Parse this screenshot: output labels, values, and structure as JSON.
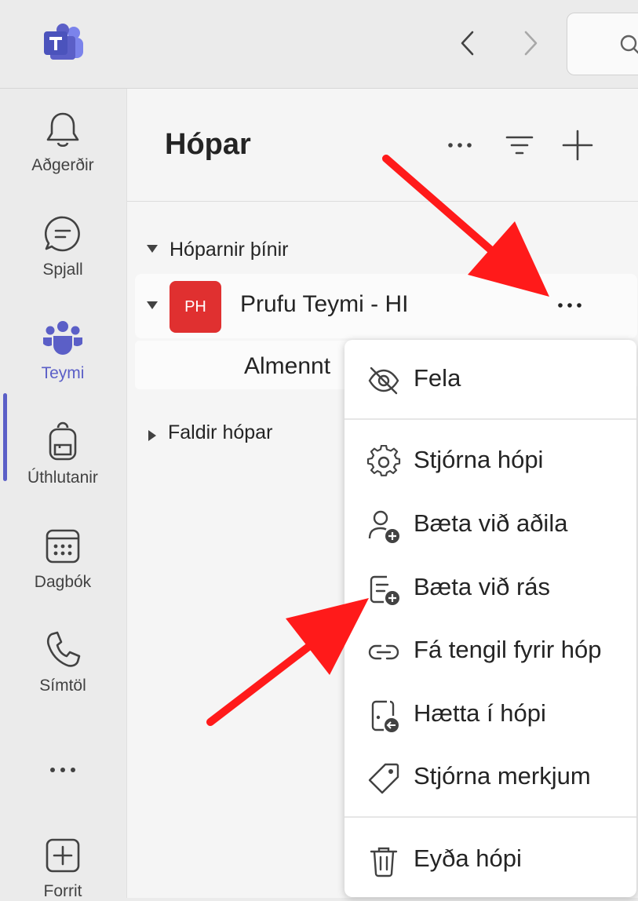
{
  "colors": {
    "accent": "#5b5fc7",
    "team_avatar": "#e03030",
    "annotation_arrow": "#ff0000"
  },
  "rail": {
    "items": [
      {
        "label": "Aðgerðir",
        "icon": "bell-icon"
      },
      {
        "label": "Spjall",
        "icon": "chat-icon"
      },
      {
        "label": "Teymi",
        "icon": "teams-icon",
        "active": true
      },
      {
        "label": "Úthlutanir",
        "icon": "backpack-icon"
      },
      {
        "label": "Dagbók",
        "icon": "calendar-icon"
      },
      {
        "label": "Símtöl",
        "icon": "phone-icon"
      },
      {
        "label": "",
        "icon": "more-icon"
      },
      {
        "label": "Forrit",
        "icon": "add-app-icon"
      }
    ]
  },
  "panel": {
    "title": "Hópar",
    "section_your_teams": "Hóparnir þínir",
    "team": {
      "avatar_initials": "PH",
      "name": "Prufu Teymi - HI"
    },
    "channel": "Almennt",
    "section_hidden": "Faldir hópar"
  },
  "context_menu": {
    "items": [
      {
        "label": "Fela",
        "icon": "eye-off-icon"
      },
      {
        "label": "Stjórna hópi",
        "icon": "gear-icon"
      },
      {
        "label": "Bæta við aðila",
        "icon": "person-add-icon"
      },
      {
        "label": "Bæta við rás",
        "icon": "channel-add-icon"
      },
      {
        "label": "Fá tengil fyrir hóp",
        "icon": "link-icon"
      },
      {
        "label": "Hætta í hópi",
        "icon": "leave-icon"
      },
      {
        "label": "Stjórna merkjum",
        "icon": "tag-icon"
      },
      {
        "label": "Eyða hópi",
        "icon": "trash-icon"
      }
    ]
  }
}
